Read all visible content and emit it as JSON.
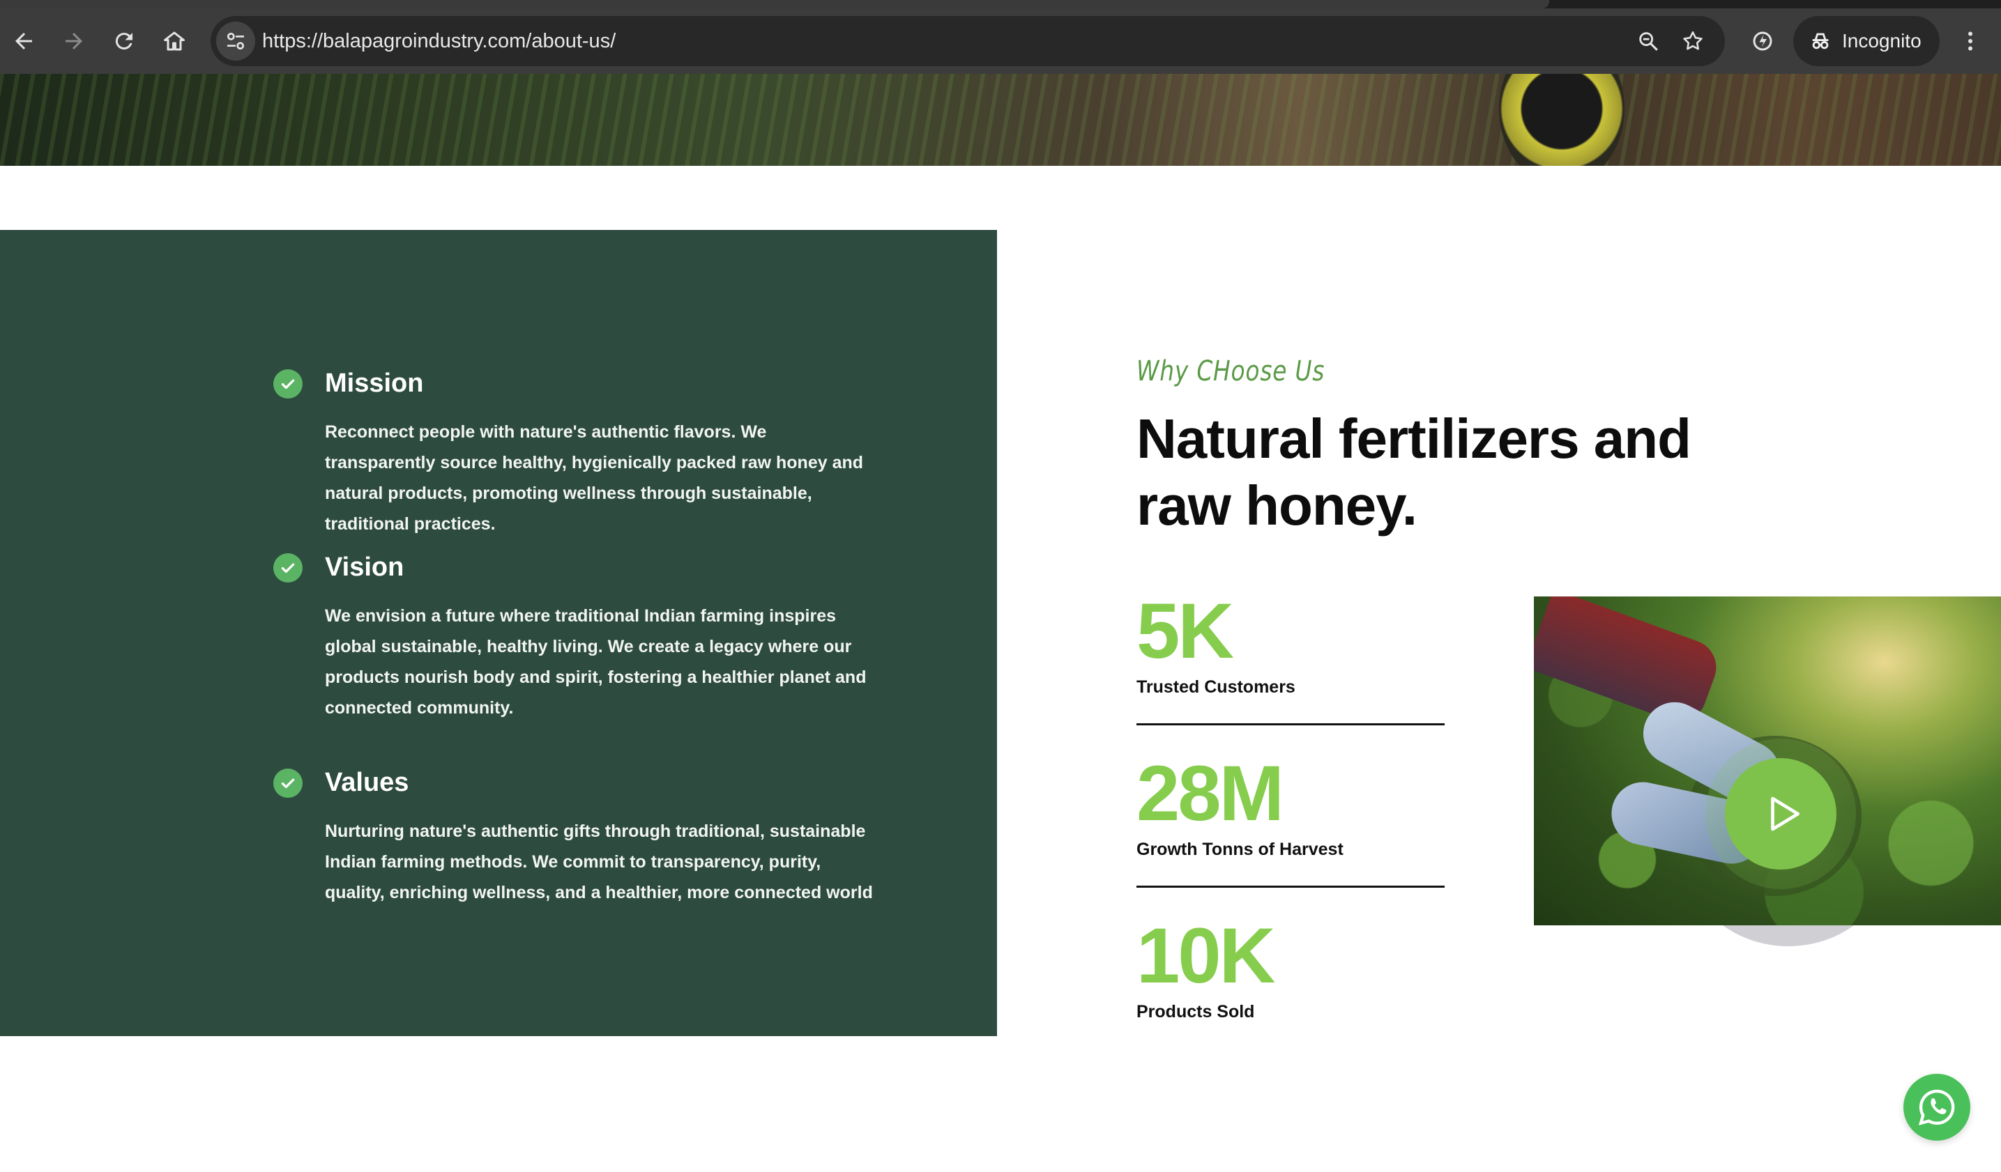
{
  "browser": {
    "url": "https://balapagroindustry.com/about-us/",
    "profile_label": "Incognito"
  },
  "sections": {
    "mission": {
      "title": "Mission",
      "text": "Reconnect people with nature's authentic flavors. We transparently source healthy, hygienically packed raw honey and natural products, promoting wellness through sustainable, traditional practices."
    },
    "vision": {
      "title": "Vision",
      "text": "We envision a future where traditional Indian farming inspires global sustainable, healthy living. We create a legacy where our products nourish body and spirit, fostering a healthier planet and connected community."
    },
    "values": {
      "title": "Values",
      "text": "Nurturing nature's authentic gifts through traditional, sustainable Indian farming methods. We commit to transparency, purity, quality, enriching wellness, and a healthier, more connected world"
    }
  },
  "why": {
    "eyebrow": "Why CHoose Us",
    "heading": "Natural fertilizers and raw honey."
  },
  "stats": [
    {
      "number": "5K",
      "label": "Trusted Customers"
    },
    {
      "number": "28M",
      "label": "Growth Tonns of Harvest"
    },
    {
      "number": "10K",
      "label": "Products Sold"
    }
  ],
  "colors": {
    "panel": "#2d4b3f",
    "accent_green": "#86cd4d",
    "check_green": "#5bb464",
    "whatsapp": "#4ac05a"
  },
  "icons": [
    "back-arrow-icon",
    "forward-arrow-icon",
    "reload-icon",
    "home-icon",
    "site-info-icon",
    "zoom-icon",
    "star-icon",
    "extension-icon",
    "incognito-icon",
    "menu-dots-icon",
    "check-icon",
    "play-icon",
    "whatsapp-icon"
  ]
}
